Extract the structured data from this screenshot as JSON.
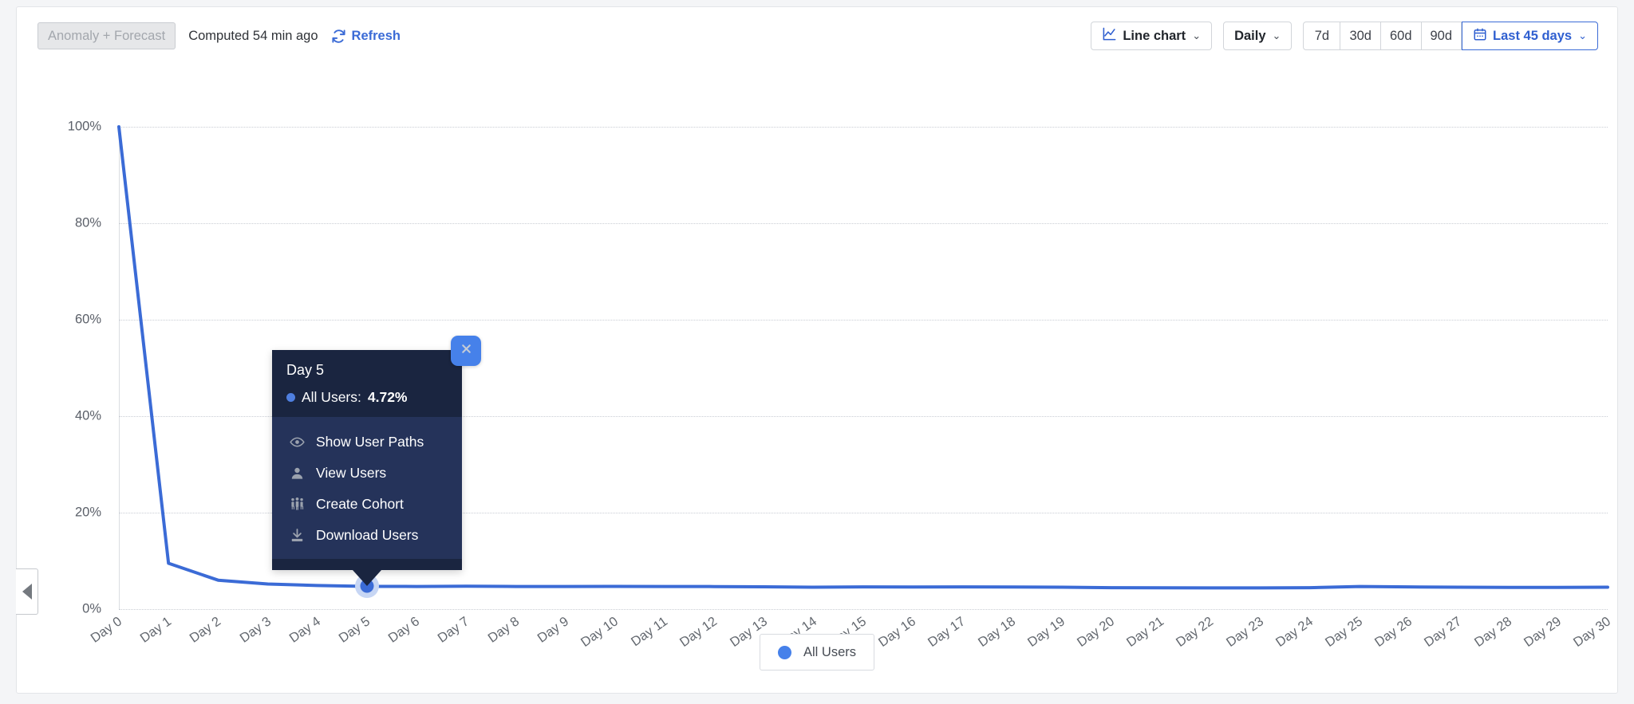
{
  "header": {
    "anomaly_button_label": "Anomaly + Forecast",
    "computed_text": "Computed 54 min ago",
    "refresh_label": "Refresh",
    "chart_type_label": "Line chart",
    "granularity_label": "Daily",
    "range_presets": [
      "7d",
      "30d",
      "60d",
      "90d"
    ],
    "active_range_label": "Last 45 days",
    "caret": "⌄"
  },
  "tooltip": {
    "title": "Day 5",
    "metric_name": "All Users:",
    "metric_value": "4.72%",
    "series_color": "#4f7fe0",
    "actions": [
      {
        "label": "Show User Paths",
        "icon": "eye-icon"
      },
      {
        "label": "View Users",
        "icon": "person-icon"
      },
      {
        "label": "Create Cohort",
        "icon": "people-group-icon"
      },
      {
        "label": "Download Users",
        "icon": "download-icon"
      }
    ],
    "close_label": "✕"
  },
  "legend": {
    "items": [
      {
        "label": "All Users",
        "color": "#4681ea"
      }
    ]
  },
  "chart_data": {
    "type": "line",
    "title": "",
    "xlabel": "",
    "ylabel": "",
    "ylim": [
      0,
      100
    ],
    "yticks": [
      0,
      20,
      40,
      60,
      80,
      100
    ],
    "ytick_labels": [
      "0%",
      "20%",
      "40%",
      "60%",
      "80%",
      "100%"
    ],
    "grid": true,
    "legend_position": "bottom",
    "categories": [
      "Day 0",
      "Day 1",
      "Day 2",
      "Day 3",
      "Day 4",
      "Day 5",
      "Day 6",
      "Day 7",
      "Day 8",
      "Day 9",
      "Day 10",
      "Day 11",
      "Day 12",
      "Day 13",
      "Day 14",
      "Day 15",
      "Day 16",
      "Day 17",
      "Day 18",
      "Day 19",
      "Day 20",
      "Day 21",
      "Day 22",
      "Day 23",
      "Day 24",
      "Day 25",
      "Day 26",
      "Day 27",
      "Day 28",
      "Day 29",
      "Day 30"
    ],
    "series": [
      {
        "name": "All Users",
        "color": "#3b6bd6",
        "values": [
          100,
          9.5,
          6.0,
          5.2,
          4.9,
          4.72,
          4.7,
          4.75,
          4.7,
          4.7,
          4.72,
          4.7,
          4.68,
          4.62,
          4.55,
          4.6,
          4.58,
          4.6,
          4.58,
          4.55,
          4.45,
          4.42,
          4.4,
          4.4,
          4.45,
          4.7,
          4.6,
          4.55,
          4.5,
          4.5,
          4.55
        ]
      }
    ],
    "highlighted_point": {
      "category": "Day 5",
      "value": 4.72,
      "series": "All Users"
    }
  },
  "sidebar_toggle": {
    "icon": "chevron-left-icon"
  }
}
